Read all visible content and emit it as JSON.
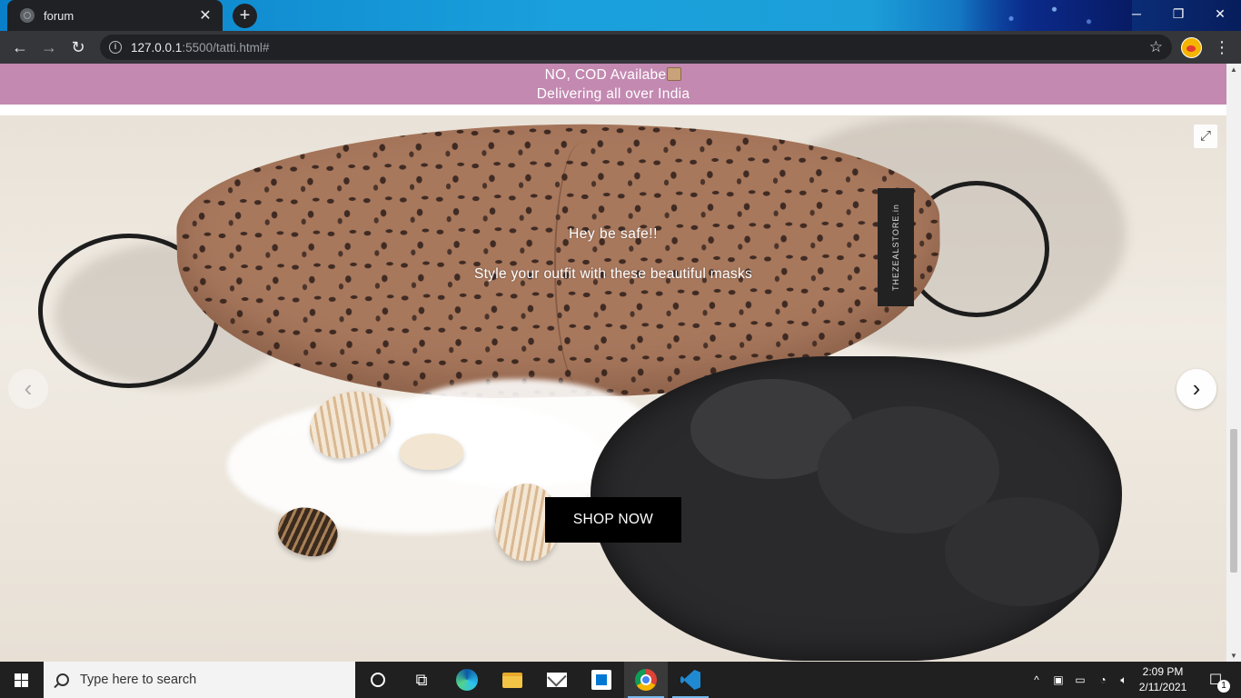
{
  "browser": {
    "tab_title": "forum",
    "tab_close": "✕",
    "new_tab": "+",
    "url_host": "127.0.0.1",
    "url_rest": ":5500/tatti.html#",
    "window_controls": {
      "minimize": "─",
      "restore": "❐",
      "close": "✕"
    },
    "icons": [
      "back-icon",
      "forward-icon",
      "reload-icon",
      "info-icon",
      "star-icon",
      "profile-avatar",
      "menu-icon"
    ]
  },
  "page": {
    "banner": {
      "line1": "NO, COD Availabe",
      "line2": "Delivering all over India"
    },
    "carousel": {
      "caption_title": "Hey be safe!!",
      "caption_text": "Style your outfit with these beautiful masks",
      "shop_button": "SHOP NOW",
      "mask_brand": "THEZEALSTORE.in",
      "prev_label": "‹",
      "next_label": "›",
      "fullscreen_label": "⤢"
    }
  },
  "taskbar": {
    "search_placeholder": "Type here to search",
    "time": "2:09 PM",
    "date": "2/11/2021",
    "notification_count": "1",
    "apps": [
      "cortana",
      "task-view",
      "edge",
      "file-explorer",
      "mail",
      "store",
      "chrome",
      "vscode"
    ]
  },
  "colors": {
    "banner_bg": "#c389b1",
    "tab_bg": "#202124",
    "toolbar_bg": "#35363a",
    "taskbar_bg": "#202020"
  }
}
